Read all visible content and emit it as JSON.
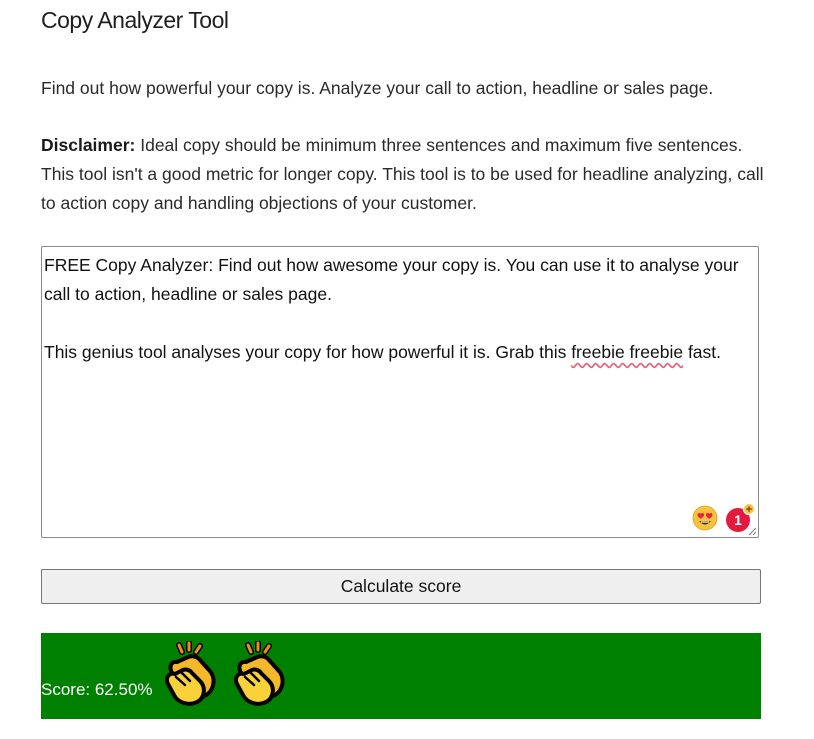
{
  "page": {
    "title": "Copy Analyzer Tool",
    "intro": "Find out how powerful your copy is. Analyze your call to action, headline or sales page.",
    "disclaimer_label": "Disclaimer:",
    "disclaimer_text": " Ideal copy should be minimum three sentences and maximum five sentences. This tool isn't a good metric for longer copy. This tool is to be used for headline analyzing, call to action copy and handling objections of your customer."
  },
  "editor": {
    "line1": "FREE Copy Analyzer: Find out how awesome your copy is. You can use it to analyse your call to action, headline or sales page.",
    "line2_before": "This genius tool analyses your copy for how powerful it is. Grab this ",
    "line2_error": "freebie freebie",
    "line2_after": " fast.",
    "emoji_icon": "heart-eyes-emoji-icon",
    "grammar_badge_count": "1",
    "grammar_badge_icon": "grammar-checker-badge-icon"
  },
  "actions": {
    "calculate_label": "Calculate score"
  },
  "result": {
    "score_text": "Score: 62.50%",
    "clap_icon": "clapping-hands-icon",
    "clap_count": 2,
    "background_color": "#008000"
  }
}
